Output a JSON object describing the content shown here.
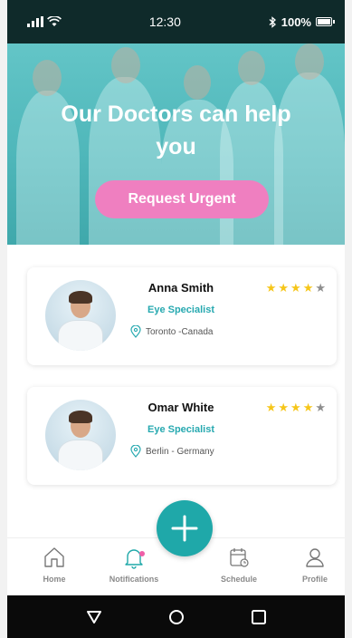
{
  "status_bar": {
    "time": "12:30",
    "battery": "100%"
  },
  "hero": {
    "title": "Our Doctors  can help you",
    "urgent_button": "Request Urgent"
  },
  "doctors": [
    {
      "name": "Anna Smith",
      "specialty": "Eye Specialist",
      "location": "Toronto -Canada",
      "rating": 4,
      "max_rating": 5
    },
    {
      "name": "Omar White",
      "specialty": "Eye Specialist",
      "location": "Berlin  - Germany",
      "rating": 4,
      "max_rating": 5
    }
  ],
  "fab": {
    "icon": "plus-icon"
  },
  "bottom_nav": {
    "home": "Home",
    "notifications": "Notifications",
    "schedule": "Schedule",
    "profile": "Profile"
  },
  "colors": {
    "accent": "#1fa8a9",
    "urgent": "#ef7fc0",
    "star": "#f6c619",
    "teal_text": "#27a9b0"
  }
}
